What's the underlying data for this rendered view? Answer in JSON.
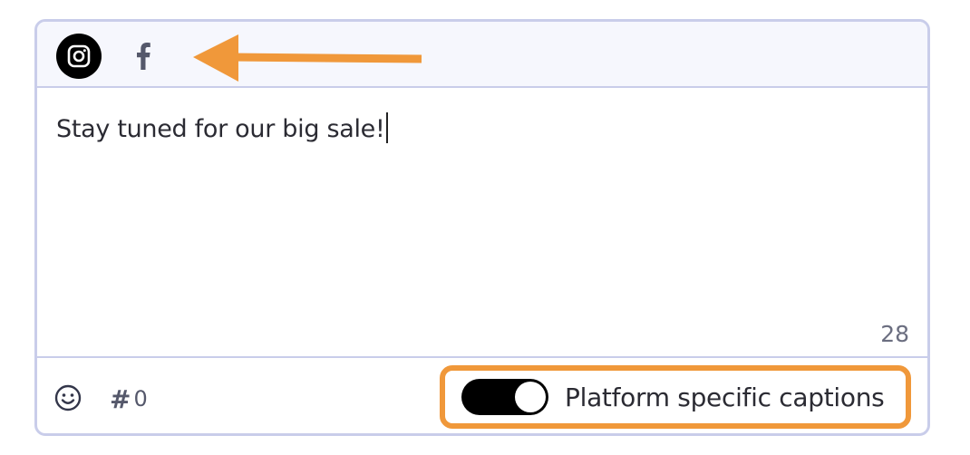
{
  "platforms": [
    {
      "name": "Instagram",
      "icon": "instagram-icon",
      "active": true
    },
    {
      "name": "Facebook",
      "icon": "facebook-icon",
      "active": false
    }
  ],
  "caption": {
    "text": "Stay tuned for our big sale!",
    "char_count": "28"
  },
  "toolbar": {
    "emoji_icon": "smiley-icon",
    "hashtag_symbol": "#",
    "hashtag_count": "0"
  },
  "toggle": {
    "label": "Platform specific captions",
    "on": true
  },
  "annotations": {
    "highlight_color": "#f0983a",
    "arrow_color": "#f0983a"
  },
  "colors": {
    "border": "#c9cdea",
    "header_bg": "#f6f7fd",
    "text": "#2b2b33",
    "muted": "#6b6e80",
    "toggle_on": "#000000"
  }
}
